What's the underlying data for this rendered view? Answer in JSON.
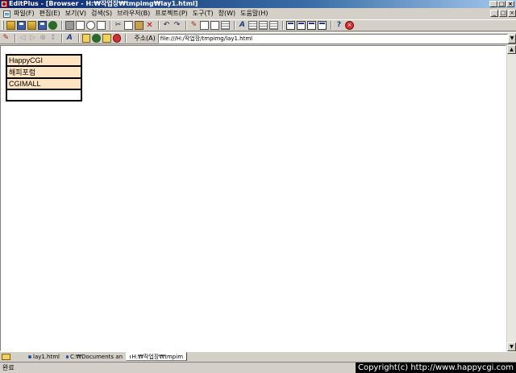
{
  "window": {
    "title": "EditPlus - [Browser - H:₩작업장₩tmpimg₩lay1.html]"
  },
  "menu": {
    "items": [
      "파일(F)",
      "편집(E)",
      "보기(V)",
      "검색(S)",
      "브라우저(B)",
      "프로젝트(P)",
      "도구(T)",
      "창(W)",
      "도움말(H)"
    ]
  },
  "address": {
    "label": "주소(A)",
    "value": "file:///H:/작업장/tmpimg/lay1.html"
  },
  "content": {
    "rows": [
      "HappyCGI",
      "해피포럼",
      "CGIMALL",
      ""
    ],
    "row_bg": "#ffe4c4"
  },
  "tabs": {
    "items": [
      "lay1.html",
      "C:₩Documents an",
      "H:₩작업장₩tmpim"
    ]
  },
  "status": {
    "text": "완료",
    "copyright": "Copyright(c) http://www.happycgi.com"
  },
  "colors": {
    "titlebar_start": "#0a246a",
    "titlebar_end": "#a6caf0",
    "chrome": "#d4d0c8"
  }
}
